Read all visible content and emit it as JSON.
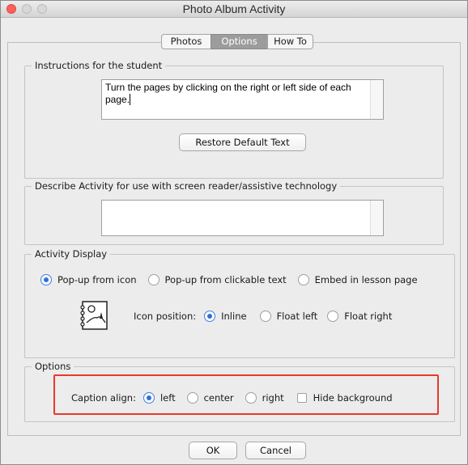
{
  "window": {
    "title": "Photo Album Activity"
  },
  "tabs": [
    {
      "label": "Photos",
      "active": false
    },
    {
      "label": "Options",
      "active": true
    },
    {
      "label": "How To",
      "active": false
    }
  ],
  "instructions": {
    "legend": "Instructions for the student",
    "text": "Turn the pages by clicking on the right or left side of each page.",
    "restore_button": "Restore Default Text"
  },
  "describe": {
    "legend": "Describe Activity for use with screen reader/assistive technology",
    "text": ""
  },
  "activity_display": {
    "legend": "Activity Display",
    "mode_options": [
      {
        "label": "Pop-up from icon",
        "selected": true
      },
      {
        "label": "Pop-up from clickable text",
        "selected": false
      },
      {
        "label": "Embed in lesson page",
        "selected": false
      }
    ],
    "icon_name": "photo-album-icon",
    "icon_position_label": "Icon position:",
    "icon_position_options": [
      {
        "label": "Inline",
        "selected": true
      },
      {
        "label": "Float left",
        "selected": false
      },
      {
        "label": "Float right",
        "selected": false
      }
    ]
  },
  "options": {
    "legend": "Options",
    "caption_align_label": "Caption align:",
    "caption_align_options": [
      {
        "label": "left",
        "selected": true
      },
      {
        "label": "center",
        "selected": false
      },
      {
        "label": "right",
        "selected": false
      }
    ],
    "hide_background_label": "Hide background",
    "hide_background_checked": false
  },
  "footer": {
    "ok_label": "OK",
    "cancel_label": "Cancel"
  },
  "colors": {
    "highlight": "#e8392b",
    "radio_selected": "#2e6fd8",
    "close_light": "#fc605b"
  }
}
